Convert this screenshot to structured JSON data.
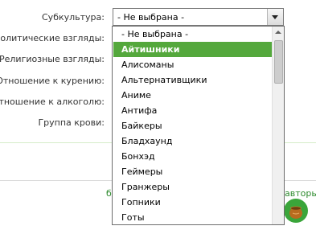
{
  "form": {
    "labels": [
      "Субкультура:",
      "Политические взгляды:",
      "Религиозные взгляды:",
      "Отношение к курению:",
      "Отношение к алкоголю:",
      "Группа крови:"
    ]
  },
  "select": {
    "value": "- Не выбрана -"
  },
  "dropdown": {
    "options": [
      "- Не выбрана -",
      "Айтишники",
      "Алисоманы",
      "Альтернативщики",
      "Аниме",
      "Антифа",
      "Байкеры",
      "Бладхаунд",
      "Бонхэд",
      "Геймеры",
      "Гранжеры",
      "Гопники",
      "Готы"
    ],
    "selected_index": 1
  },
  "footer": {
    "left_fragment": "б",
    "right_fragment": "авторы"
  },
  "colors": {
    "highlight": "#54a83c",
    "divider_green": "#cfe9c4",
    "link_green": "#2e8b2e"
  },
  "icons": {
    "pot": "pot-icon",
    "dropdown_arrow": "chevron-down-icon"
  }
}
